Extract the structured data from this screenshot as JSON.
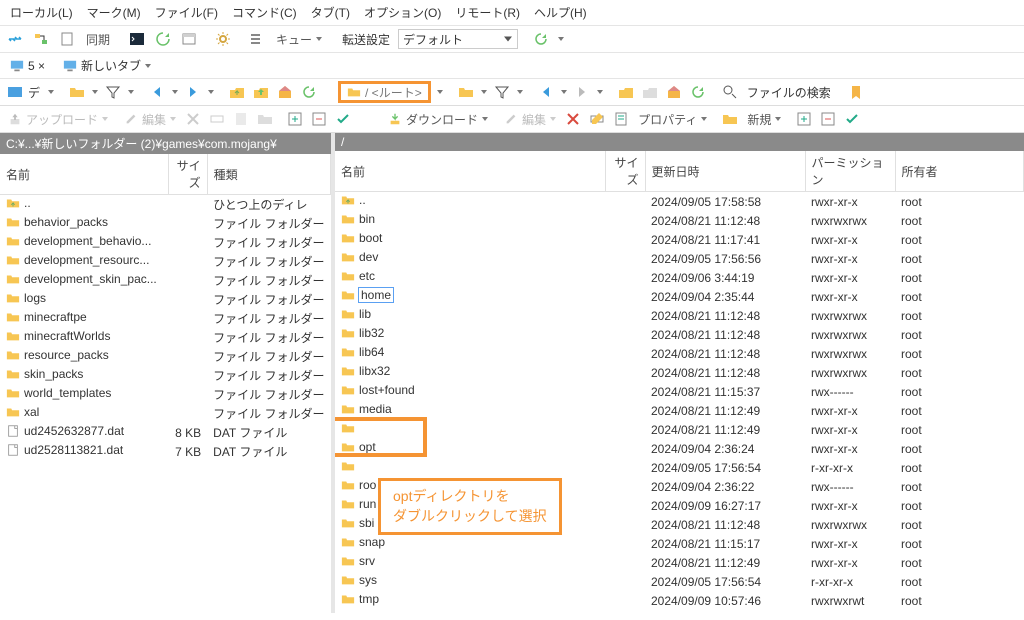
{
  "menu": [
    {
      "label": "ローカル(L)"
    },
    {
      "label": "マーク(M)"
    },
    {
      "label": "ファイル(F)"
    },
    {
      "label": "コマンド(C)"
    },
    {
      "label": "タブ(T)"
    },
    {
      "label": "オプション(O)"
    },
    {
      "label": "リモート(R)"
    },
    {
      "label": "ヘルプ(H)"
    }
  ],
  "toolbar": {
    "sync_label": "同期",
    "queue_label": "キュー",
    "transfer_label": "転送設定",
    "transfer_value": "デフォルト",
    "new_tab": "新しいタブ",
    "tab_close": "5 ×",
    "upload": "アップロード",
    "download": "ダウンロード",
    "edit": "編集",
    "property": "プロパティ",
    "new": "新規",
    "search": "ファイルの検索",
    "path_box": "/ <ルート>",
    "drive_label": "デ"
  },
  "left": {
    "path": "C:¥...¥新しいフォルダー (2)¥games¥com.mojang¥",
    "cols": [
      "名前",
      "サイズ",
      "種類"
    ],
    "rows": [
      {
        "icon": "parent",
        "name": "..",
        "size": "",
        "type": "ひとつ上のディレ"
      },
      {
        "icon": "folder",
        "name": "behavior_packs",
        "size": "",
        "type": "ファイル フォルダー"
      },
      {
        "icon": "folder",
        "name": "development_behavio...",
        "size": "",
        "type": "ファイル フォルダー"
      },
      {
        "icon": "folder",
        "name": "development_resourc...",
        "size": "",
        "type": "ファイル フォルダー"
      },
      {
        "icon": "folder",
        "name": "development_skin_pac...",
        "size": "",
        "type": "ファイル フォルダー"
      },
      {
        "icon": "folder",
        "name": "logs",
        "size": "",
        "type": "ファイル フォルダー"
      },
      {
        "icon": "folder",
        "name": "minecraftpe",
        "size": "",
        "type": "ファイル フォルダー"
      },
      {
        "icon": "folder",
        "name": "minecraftWorlds",
        "size": "",
        "type": "ファイル フォルダー"
      },
      {
        "icon": "folder",
        "name": "resource_packs",
        "size": "",
        "type": "ファイル フォルダー"
      },
      {
        "icon": "folder",
        "name": "skin_packs",
        "size": "",
        "type": "ファイル フォルダー"
      },
      {
        "icon": "folder",
        "name": "world_templates",
        "size": "",
        "type": "ファイル フォルダー"
      },
      {
        "icon": "folder",
        "name": "xal",
        "size": "",
        "type": "ファイル フォルダー"
      },
      {
        "icon": "file",
        "name": "ud2452632877.dat",
        "size": "8 KB",
        "type": "DAT ファイル"
      },
      {
        "icon": "file",
        "name": "ud2528113821.dat",
        "size": "7 KB",
        "type": "DAT ファイル"
      }
    ]
  },
  "right": {
    "path": "/",
    "cols": [
      "名前",
      "サイズ",
      "更新日時",
      "パーミッション",
      "所有者"
    ],
    "rows": [
      {
        "icon": "parent",
        "name": "..",
        "date": "2024/09/05 17:58:58",
        "perm": "rwxr-xr-x",
        "owner": "root"
      },
      {
        "icon": "folder",
        "name": "bin",
        "date": "2024/08/21 11:12:48",
        "perm": "rwxrwxrwx",
        "owner": "root"
      },
      {
        "icon": "folder",
        "name": "boot",
        "date": "2024/08/21 11:17:41",
        "perm": "rwxr-xr-x",
        "owner": "root"
      },
      {
        "icon": "folder",
        "name": "dev",
        "date": "2024/09/05 17:56:56",
        "perm": "rwxr-xr-x",
        "owner": "root"
      },
      {
        "icon": "folder",
        "name": "etc",
        "date": "2024/09/06 3:44:19",
        "perm": "rwxr-xr-x",
        "owner": "root"
      },
      {
        "icon": "folder",
        "name": "home",
        "date": "2024/09/04 2:35:44",
        "perm": "rwxr-xr-x",
        "owner": "root",
        "selected": true
      },
      {
        "icon": "folder",
        "name": "lib",
        "date": "2024/08/21 11:12:48",
        "perm": "rwxrwxrwx",
        "owner": "root"
      },
      {
        "icon": "folder",
        "name": "lib32",
        "date": "2024/08/21 11:12:48",
        "perm": "rwxrwxrwx",
        "owner": "root"
      },
      {
        "icon": "folder",
        "name": "lib64",
        "date": "2024/08/21 11:12:48",
        "perm": "rwxrwxrwx",
        "owner": "root"
      },
      {
        "icon": "folder",
        "name": "libx32",
        "date": "2024/08/21 11:12:48",
        "perm": "rwxrwxrwx",
        "owner": "root"
      },
      {
        "icon": "folder",
        "name": "lost+found",
        "date": "2024/08/21 11:15:37",
        "perm": "rwx------",
        "owner": "root"
      },
      {
        "icon": "folder",
        "name": "media",
        "date": "2024/08/21 11:12:49",
        "perm": "rwxr-xr-x",
        "owner": "root"
      },
      {
        "icon": "folder",
        "name": "",
        "date": "2024/08/21 11:12:49",
        "perm": "rwxr-xr-x",
        "owner": "root",
        "hidden_by_callout": true
      },
      {
        "icon": "folder",
        "name": "opt",
        "date": "2024/09/04 2:36:24",
        "perm": "rwxr-xr-x",
        "owner": "root",
        "highlight_box": true
      },
      {
        "icon": "folder",
        "name": "",
        "date": "2024/09/05 17:56:54",
        "perm": "r-xr-xr-x",
        "owner": "root",
        "name_hidden": true
      },
      {
        "icon": "folder",
        "name": "roo",
        "date": "2024/09/04 2:36:22",
        "perm": "rwx------",
        "owner": "root",
        "name_truncated": true
      },
      {
        "icon": "folder",
        "name": "run",
        "date": "2024/09/09 16:27:17",
        "perm": "rwxr-xr-x",
        "owner": "root",
        "name_truncated": true
      },
      {
        "icon": "folder",
        "name": "sbi",
        "date": "2024/08/21 11:12:48",
        "perm": "rwxrwxrwx",
        "owner": "root",
        "name_truncated": true
      },
      {
        "icon": "folder",
        "name": "snap",
        "date": "2024/08/21 11:15:17",
        "perm": "rwxr-xr-x",
        "owner": "root"
      },
      {
        "icon": "folder",
        "name": "srv",
        "date": "2024/08/21 11:12:49",
        "perm": "rwxr-xr-x",
        "owner": "root"
      },
      {
        "icon": "folder",
        "name": "sys",
        "date": "2024/09/05 17:56:54",
        "perm": "r-xr-xr-x",
        "owner": "root"
      },
      {
        "icon": "folder",
        "name": "tmp",
        "date": "2024/09/09 10:57:46",
        "perm": "rwxrwxrwt",
        "owner": "root"
      }
    ]
  },
  "callout": {
    "line1": "optディレクトリを",
    "line2": "ダブルクリックして選択"
  }
}
